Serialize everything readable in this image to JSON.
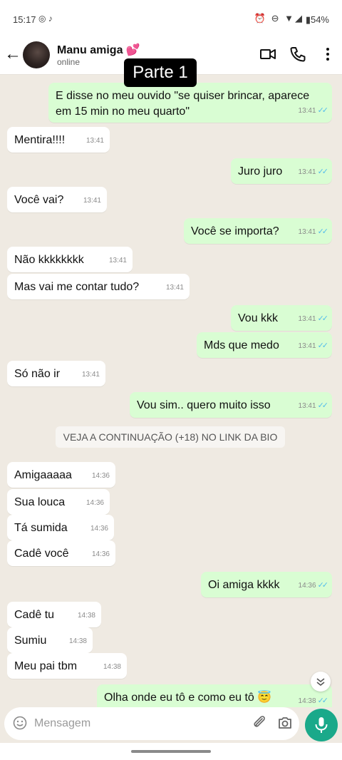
{
  "status_bar": {
    "time": "15:17",
    "left_icons": "◎ ♪",
    "right_icons": "⏰ ⊖ ▼◢",
    "battery": "▮54%"
  },
  "header": {
    "contact_name": "Manu amiga 💕",
    "status": "online",
    "back_icon": "←",
    "video_icon": "video-call-icon",
    "call_icon": "phone-icon",
    "menu_icon": "more-vert-icon"
  },
  "overlay_label": "Parte 1",
  "messages": [
    {
      "dir": "out",
      "text": "E disse no meu ouvido \"se quiser brincar, aparece em 15 min no meu quarto\"",
      "time": "13:41",
      "ticks": "✓✓"
    },
    {
      "dir": "in",
      "text": "Mentira!!!!",
      "time": "13:41"
    },
    {
      "dir": "out",
      "text": "Juro juro",
      "time": "13:41",
      "ticks": "✓✓"
    },
    {
      "dir": "in",
      "text": "Você vai?",
      "time": "13:41"
    },
    {
      "dir": "out",
      "text": "Você se importa?",
      "time": "13:41",
      "ticks": "✓✓"
    },
    {
      "dir": "in",
      "text": "Não kkkkkkkk",
      "time": "13:41"
    },
    {
      "dir": "in",
      "text": "Mas vai me contar tudo?",
      "time": "13:41"
    },
    {
      "dir": "out",
      "text": "Vou kkk",
      "time": "13:41",
      "ticks": "✓✓"
    },
    {
      "dir": "out",
      "text": "Mds que medo",
      "time": "13:41",
      "ticks": "✓✓"
    },
    {
      "dir": "in",
      "text": "Só não ir",
      "time": "13:41"
    },
    {
      "dir": "out",
      "text": "Vou sim.. quero muito isso",
      "time": "13:41",
      "ticks": "✓✓"
    },
    {
      "dir": "in",
      "text": "Amigaaaaa",
      "time": "14:36"
    },
    {
      "dir": "in",
      "text": "Sua louca",
      "time": "14:36"
    },
    {
      "dir": "in",
      "text": "Tá sumida",
      "time": "14:36"
    },
    {
      "dir": "in",
      "text": "Cadê você",
      "time": "14:36"
    },
    {
      "dir": "out",
      "text": "Oi amiga kkkk",
      "time": "14:36",
      "ticks": "✓✓"
    },
    {
      "dir": "in",
      "text": "Cadê tu",
      "time": "14:38"
    },
    {
      "dir": "in",
      "text": "Sumiu",
      "time": "14:38"
    },
    {
      "dir": "in",
      "text": "Meu pai tbm",
      "time": "14:38"
    },
    {
      "dir": "out",
      "text": "Olha onde eu tô e como eu tô 😇",
      "time": "14:38",
      "ticks": "✓✓"
    }
  ],
  "system_message": "VEJA A CONTINUAÇÃO (+18) NO LINK DA BIO",
  "scroll_down_icon": "chevrons-down-icon",
  "composer": {
    "placeholder": "Mensagem",
    "accent_color": "#1aa98a"
  }
}
